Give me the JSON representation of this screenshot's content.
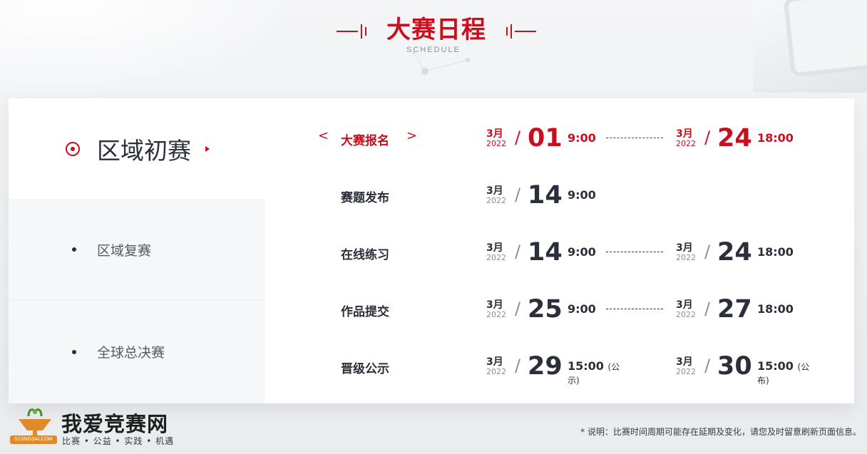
{
  "header": {
    "title": "大赛日程",
    "subtitle": "SCHEDULE"
  },
  "sidebar": {
    "items": [
      {
        "label": "区域初赛",
        "active": true
      },
      {
        "label": "区域复赛",
        "active": false
      },
      {
        "label": "全球总决赛",
        "active": false
      }
    ]
  },
  "schedule": [
    {
      "label": "大赛报名",
      "highlight": true,
      "start": {
        "month": "3月",
        "year": "2022",
        "day": "01",
        "time": "9:00",
        "note": ""
      },
      "end": {
        "month": "3月",
        "year": "2022",
        "day": "24",
        "time": "18:00",
        "note": ""
      }
    },
    {
      "label": "赛题发布",
      "highlight": false,
      "start": {
        "month": "3月",
        "year": "2022",
        "day": "14",
        "time": "9:00",
        "note": ""
      },
      "end": null
    },
    {
      "label": "在线练习",
      "highlight": false,
      "start": {
        "month": "3月",
        "year": "2022",
        "day": "14",
        "time": "9:00",
        "note": ""
      },
      "end": {
        "month": "3月",
        "year": "2022",
        "day": "24",
        "time": "18:00",
        "note": ""
      }
    },
    {
      "label": "作品提交",
      "highlight": false,
      "start": {
        "month": "3月",
        "year": "2022",
        "day": "25",
        "time": "9:00",
        "note": ""
      },
      "end": {
        "month": "3月",
        "year": "2022",
        "day": "27",
        "time": "18:00",
        "note": ""
      }
    },
    {
      "label": "晋级公示",
      "highlight": false,
      "start": {
        "month": "3月",
        "year": "2022",
        "day": "29",
        "time": "15:00",
        "note": "(公示)"
      },
      "end": {
        "month": "3月",
        "year": "2022",
        "day": "30",
        "time": "15:00",
        "note": "(公布)"
      }
    }
  ],
  "nav": {
    "prev": "<",
    "next": ">"
  },
  "logo": {
    "brand": "我爱竞赛网",
    "tagline": "比赛 • 公益 • 实践 • 机遇",
    "badge": "52JINGSAI.COM"
  },
  "footnote": "* 说明：比赛时间周期可能存在延期及变化，请您及时留意刷新页面信息。",
  "colors": {
    "accent": "#c80f1e",
    "text": "#2b2f3a",
    "muted": "#8b8f97"
  }
}
